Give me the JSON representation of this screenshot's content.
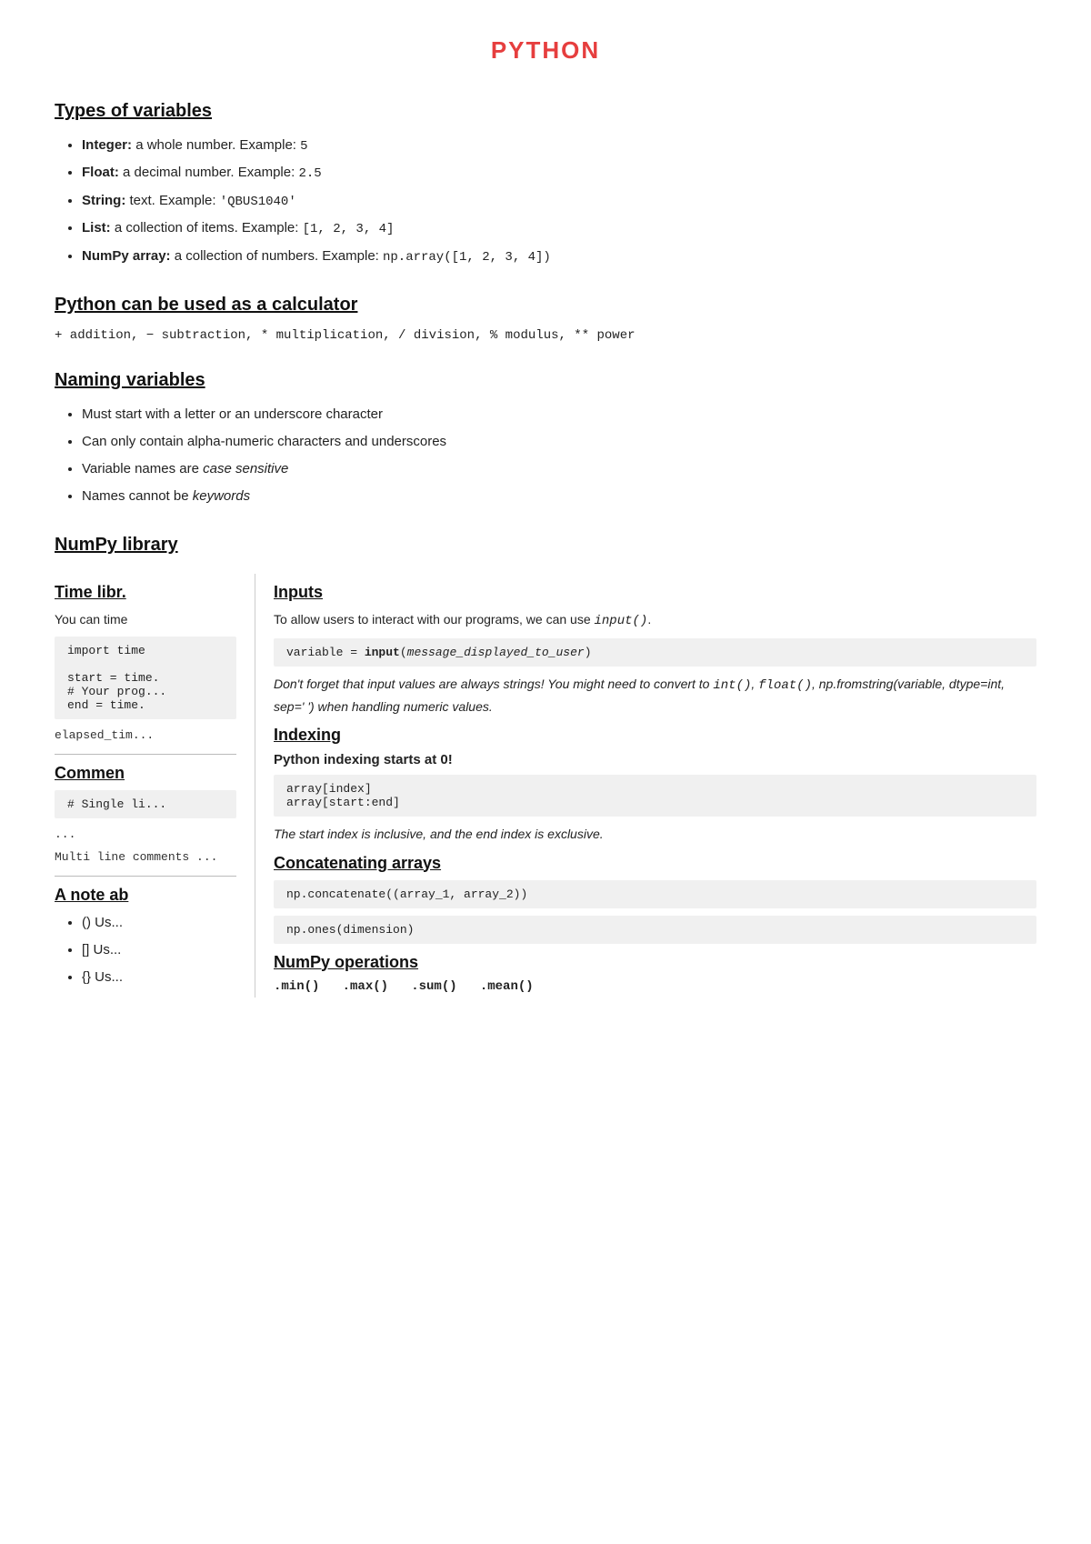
{
  "page": {
    "title": "PYTHON",
    "sections": [
      {
        "id": "types-of-variables",
        "heading": "Types of variables",
        "items": [
          {
            "label": "Integer:",
            "text": " a whole number. Example: ",
            "code": "5"
          },
          {
            "label": "Float:",
            "text": " a decimal number. Example: ",
            "code": "2.5"
          },
          {
            "label": "String:",
            "text": " text. Example: ",
            "code": "'QBUS1040'"
          },
          {
            "label": "List:",
            "text": " a collection of items. Example: ",
            "code": "[1, 2, 3, 4]"
          },
          {
            "label": "NumPy array:",
            "text": " a collection of numbers. Example: ",
            "code": "np.array([1, 2, 3, 4])"
          }
        ]
      },
      {
        "id": "calculator",
        "heading": "Python can be used as a calculator",
        "line": "+ addition, − subtraction, * multiplication, / division, % modulus, ** power"
      },
      {
        "id": "naming-variables",
        "heading": "Naming variables",
        "items": [
          "Must start with a letter or an underscore character",
          "Can only contain alpha-numeric characters and underscores",
          {
            "italic": "Variable names are ",
            "italic_word": "case sensitive"
          },
          {
            "italic": "Names cannot be ",
            "italic_word": "keywords"
          }
        ]
      },
      {
        "id": "numpy-library",
        "heading": "NumPy library"
      }
    ],
    "left_col": {
      "sections": [
        {
          "id": "time-library",
          "heading": "Time libr.",
          "intro": "You can time",
          "code_lines": [
            "import time",
            "",
            "start = time.",
            "# Your prog...",
            "end = time."
          ],
          "extra_line": "elapsed_tim..."
        },
        {
          "id": "comments",
          "heading": "Commen",
          "items": [
            {
              "code": "# Single li..."
            }
          ],
          "multiline_label": "...",
          "multiline_code": "Multi line\ncomments\n..."
        },
        {
          "id": "note-about",
          "heading": "A note ab"
        },
        {
          "items": [
            "() Us...",
            "[] Us...",
            "{} Us..."
          ]
        }
      ]
    },
    "right_col": {
      "sections": [
        {
          "id": "inputs",
          "heading": "Inputs",
          "intro": "To allow users to interact with our programs, we can use input().",
          "code_block": "variable = input(message_displayed_to_user)",
          "note": "Don't forget that input values are always strings! You might need to convert to int(), float(), np.fromstring(variable, dtype=int, sep=' ') when handling numeric values."
        },
        {
          "id": "indexing",
          "heading": "Indexing",
          "bold_line": "Python indexing starts at 0!",
          "code_block": "array[index]\narray[start:end]",
          "note": "The start index is inclusive, and the end index is exclusive."
        },
        {
          "id": "concatenating-arrays",
          "heading": "Concatenating arrays",
          "code_block1": "np.concatenate((array_1, array_2))",
          "code_block2": "np.ones(dimension)"
        },
        {
          "id": "numpy-operations",
          "heading": "NumPy operations",
          "ops_line": ".min()   .max()   .sum()   .mean()"
        }
      ]
    }
  }
}
